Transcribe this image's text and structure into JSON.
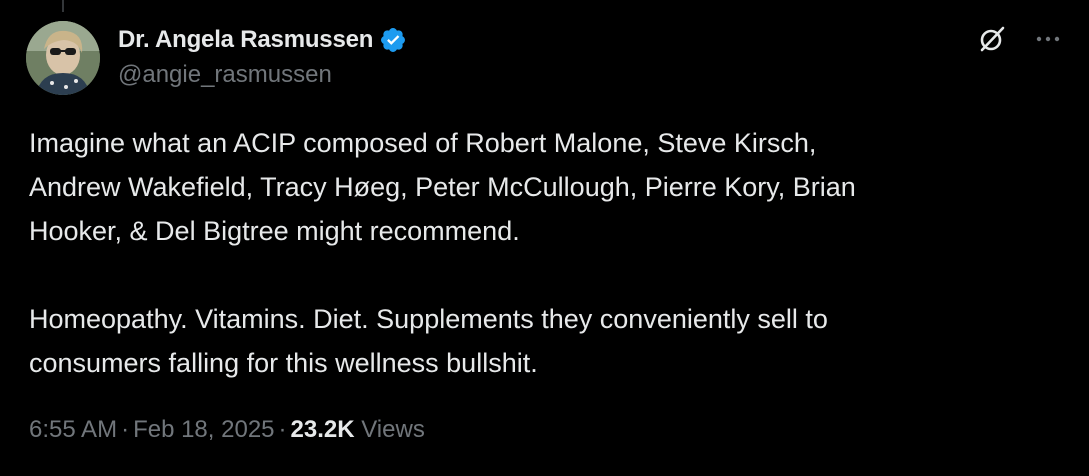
{
  "tweet": {
    "author": {
      "display_name": "Dr. Angela Rasmussen",
      "handle": "@angie_rasmussen",
      "verified_icon": "verified-badge-icon"
    },
    "text": {
      "paragraph_1_line_1": "Imagine what an ACIP composed of Robert Malone, Steve Kirsch,",
      "paragraph_1_line_2": "Andrew Wakefield, Tracy Høeg, Peter McCullough, Pierre Kory, Brian",
      "paragraph_1_line_3": "Hooker, & Del Bigtree might recommend.",
      "paragraph_2_line_1": "Homeopathy. Vitamins. Diet. Supplements they conveniently sell to",
      "paragraph_2_line_2": "consumers falling for this wellness bullshit."
    },
    "meta": {
      "time": "6:55 AM",
      "separator": "·",
      "date": "Feb 18, 2025",
      "views_count": "23.2K",
      "views_label": "Views"
    }
  },
  "colors": {
    "background": "#000000",
    "primary_text": "#e7e9ea",
    "secondary_text": "#71767b",
    "verified_blue": "#1d9bf0"
  },
  "icons": {
    "grok": "grok-icon",
    "more": "more-options-icon"
  }
}
